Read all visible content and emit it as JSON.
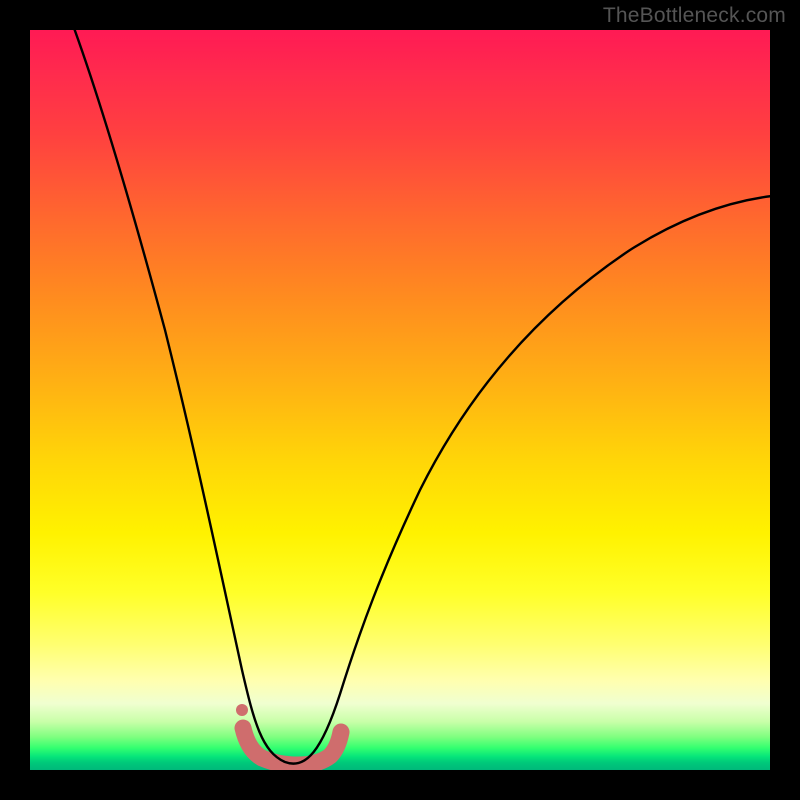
{
  "watermark": "TheBottleneck.com",
  "chart_data": {
    "type": "line",
    "title": "",
    "xlabel": "",
    "ylabel": "",
    "xlim": [
      0,
      100
    ],
    "ylim": [
      0,
      100
    ],
    "series": [
      {
        "name": "bottleneck-curve",
        "x": [
          5,
          8,
          12,
          16,
          20,
          24,
          27,
          29,
          31,
          32,
          33,
          34,
          36,
          38,
          40,
          42,
          44,
          48,
          54,
          62,
          72,
          84,
          100
        ],
        "y": [
          100,
          88,
          74,
          60,
          46,
          32,
          20,
          12,
          6,
          3,
          1,
          1,
          1,
          3,
          7,
          12,
          18,
          28,
          40,
          52,
          62,
          70,
          77
        ]
      },
      {
        "name": "highlight-bar",
        "x": [
          29,
          31,
          33,
          35,
          37,
          40
        ],
        "y": [
          5,
          1,
          0.5,
          0.5,
          1,
          5
        ]
      }
    ],
    "colors": {
      "curve": "#000000",
      "highlight": "#d07070",
      "gradient_top": "#ff1a54",
      "gradient_mid": "#ffff28",
      "gradient_bottom": "#00b87a"
    }
  }
}
